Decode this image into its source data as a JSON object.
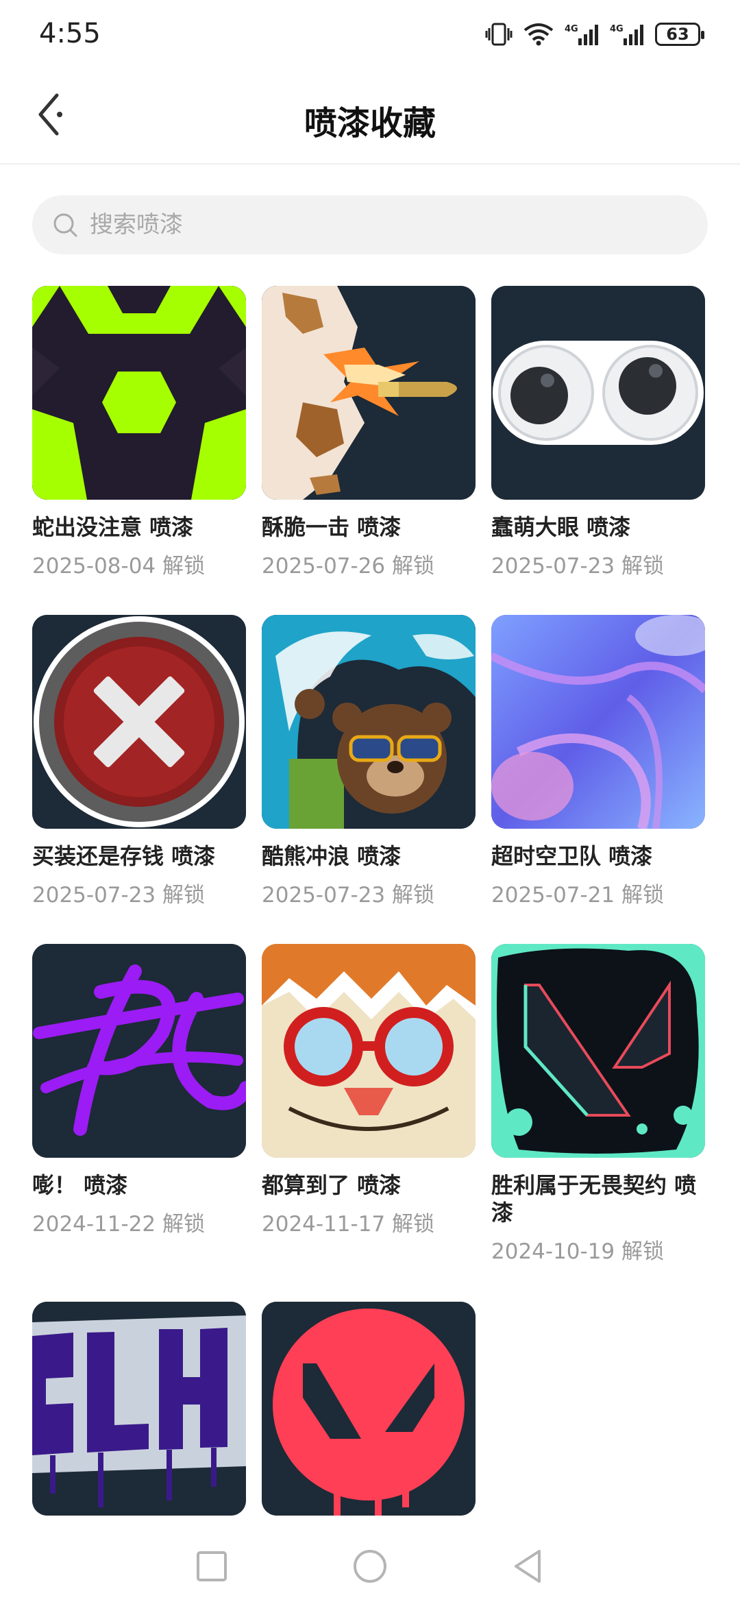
{
  "status_bar": {
    "time": "4:55",
    "battery": "63",
    "icons": [
      "vibrate-icon",
      "wifi-icon",
      "signal-4g-icon",
      "signal-4g-icon",
      "battery-icon"
    ]
  },
  "header": {
    "title": "喷漆收藏",
    "back_icon": "back-arrow-icon"
  },
  "search": {
    "placeholder": "搜索喷漆",
    "value": ""
  },
  "sprays": [
    {
      "name": "蛇出没注意 喷漆",
      "date": "2025-08-04 解锁"
    },
    {
      "name": "酥脆一击 喷漆",
      "date": "2025-07-26 解锁"
    },
    {
      "name": "蠢萌大眼 喷漆",
      "date": "2025-07-23 解锁"
    },
    {
      "name": "买装还是存钱 喷漆",
      "date": "2025-07-23 解锁"
    },
    {
      "name": "酷熊冲浪 喷漆",
      "date": "2025-07-23 解锁"
    },
    {
      "name": "超时空卫队 喷漆",
      "date": "2025-07-21 解锁"
    },
    {
      "name": "嘭！ 喷漆",
      "date": "2024-11-22 解锁"
    },
    {
      "name": "都算到了 喷漆",
      "date": "2024-11-17 解锁"
    },
    {
      "name": "胜利属于无畏契约 喷漆",
      "date": "2024-10-19 解锁"
    },
    {
      "name": "",
      "date": ""
    },
    {
      "name": "",
      "date": ""
    }
  ],
  "nav": {
    "icons": [
      "recent-apps-icon",
      "home-icon",
      "back-icon"
    ]
  }
}
